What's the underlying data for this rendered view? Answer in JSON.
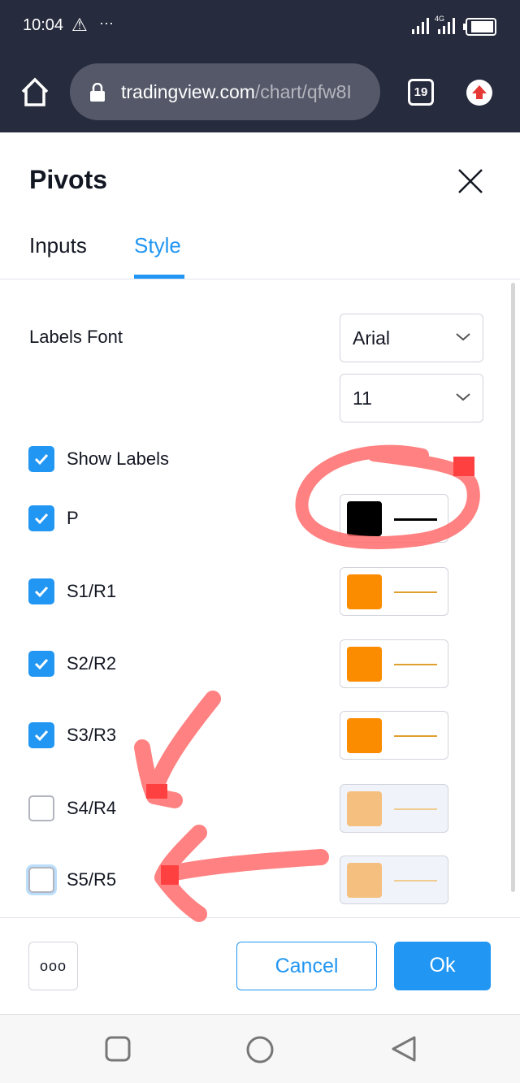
{
  "status_bar": {
    "time": "10:04",
    "network": "4G"
  },
  "browser": {
    "url_domain": "tradingview.com",
    "url_path": "/chart/qfw8I",
    "tab_count": "19"
  },
  "dialog": {
    "title": "Pivots",
    "tabs": [
      {
        "label": "Inputs",
        "active": false
      },
      {
        "label": "Style",
        "active": true
      }
    ],
    "labels_font": {
      "label": "Labels Font",
      "font": "Arial",
      "size": "11"
    },
    "rows": [
      {
        "label": "Show Labels",
        "checked": true
      },
      {
        "label": "P",
        "checked": true,
        "color": "#000000",
        "line_color": "#000000"
      },
      {
        "label": "S1/R1",
        "checked": true,
        "color": "#fb8c00",
        "line_color": "#e0a030"
      },
      {
        "label": "S2/R2",
        "checked": true,
        "color": "#fb8c00",
        "line_color": "#e0a030"
      },
      {
        "label": "S3/R3",
        "checked": true,
        "color": "#fb8c00",
        "line_color": "#e0a030"
      },
      {
        "label": "S4/R4",
        "checked": false,
        "color": "#f5c07f",
        "line_color": "#f0cc90"
      },
      {
        "label": "S5/R5",
        "checked": false,
        "color": "#f5c07f",
        "line_color": "#f0cc90"
      }
    ],
    "footer": {
      "more": "ooo",
      "cancel": "Cancel",
      "ok": "Ok"
    }
  },
  "colors": {
    "accent": "#2196f3",
    "annotation": "#ff6b6b"
  }
}
